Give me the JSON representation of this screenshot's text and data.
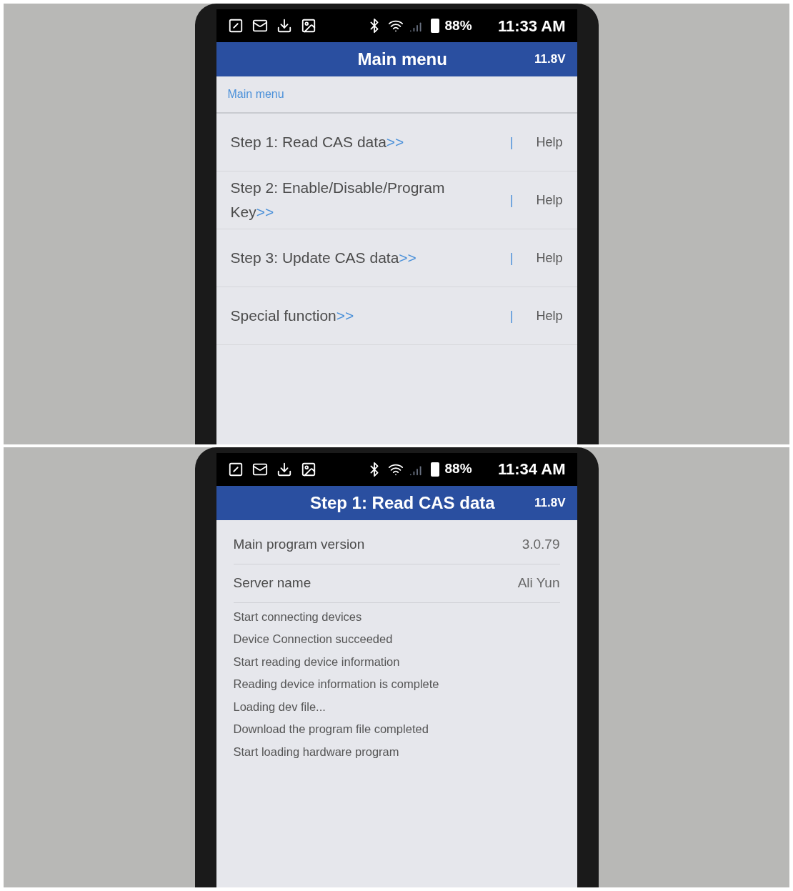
{
  "frames": [
    {
      "kind": "menu",
      "status_bar": {
        "battery": "88%",
        "time": "11:33 AM"
      },
      "header": {
        "title": "Main menu",
        "voltage": "11.8V"
      },
      "breadcrumb": "Main menu",
      "menu_items": [
        {
          "label": "Step 1: Read CAS data",
          "arrow": ">>",
          "separator": "|",
          "help": "Help"
        },
        {
          "label": "Step 2: Enable/Disable/Program Key",
          "arrow": ">>",
          "separator": "|",
          "help": "Help"
        },
        {
          "label": "Step 3: Update CAS data",
          "arrow": ">>",
          "separator": "|",
          "help": "Help"
        },
        {
          "label": "Special function",
          "arrow": ">>",
          "separator": "|",
          "help": "Help"
        }
      ]
    },
    {
      "kind": "log",
      "status_bar": {
        "battery": "88%",
        "time": "11:34 AM"
      },
      "header": {
        "title": "Step 1: Read CAS data",
        "voltage": "11.8V"
      },
      "info_rows": [
        {
          "label": "Main program version",
          "value": "3.0.79"
        },
        {
          "label": "Server name",
          "value": "Ali Yun"
        }
      ],
      "log": [
        "Start connecting devices",
        "Device Connection succeeded",
        "Start reading device information",
        "Reading device information is complete",
        "Loading dev file...",
        "Download the program file completed",
        "Start loading hardware program"
      ]
    }
  ]
}
